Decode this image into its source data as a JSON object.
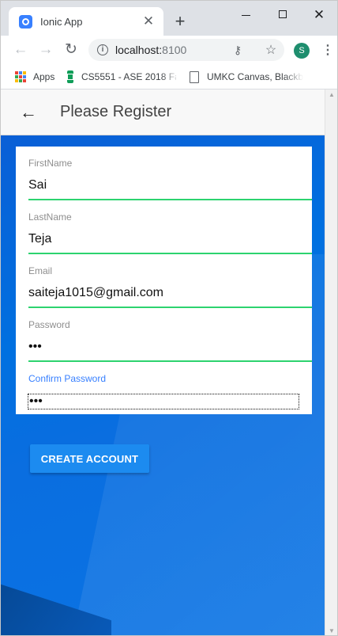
{
  "browser": {
    "tab_title": "Ionic App",
    "url_host": "localhost:",
    "url_port": "8100",
    "profile_initial": "S",
    "bookmarks": [
      {
        "label": "Apps"
      },
      {
        "label": "CS5551 - ASE 2018 Fa"
      },
      {
        "label": "UMKC Canvas, Blackb"
      }
    ],
    "colors": {
      "tab_strip": "#dee1e6",
      "profile_avatar": "#1e8e6e",
      "ionic_blue": "#3880ff"
    }
  },
  "header": {
    "title": "Please Register",
    "back_icon": "arrow-back-icon"
  },
  "form": {
    "fields": [
      {
        "label": "FirstName",
        "value": "Sai"
      },
      {
        "label": "LastName",
        "value": "Teja"
      },
      {
        "label": "Email",
        "value": "saiteja1015@gmail.com"
      },
      {
        "label": "Password",
        "value": "•••"
      },
      {
        "label": "Confirm Password",
        "value": "•••",
        "focused": true
      }
    ],
    "underline_color": "#2dd36f",
    "focus_label_color": "#3880ff"
  },
  "actions": {
    "create_account_label": "CREATE ACCOUNT",
    "button_color": "#1c8bf0"
  }
}
